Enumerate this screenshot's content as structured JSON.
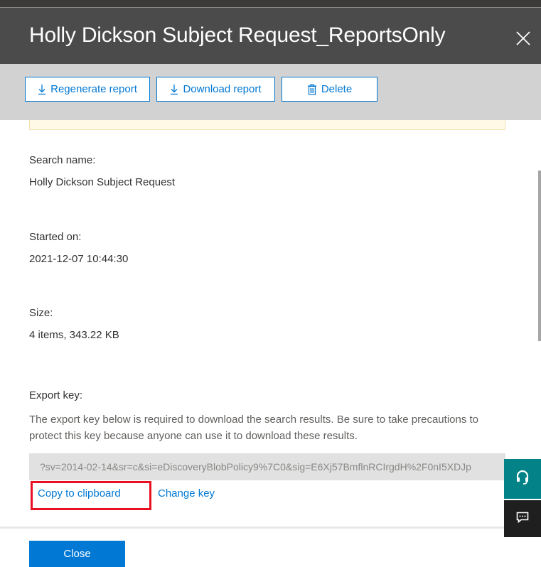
{
  "panel": {
    "title": "Holly Dickson Subject Request_ReportsOnly"
  },
  "toolbar": {
    "regenerate_label": "Regenerate report",
    "download_label": "Download report",
    "delete_label": "Delete"
  },
  "details": {
    "search_name_label": "Search name:",
    "search_name_value": "Holly Dickson Subject Request",
    "started_on_label": "Started on:",
    "started_on_value": "2021-12-07 10:44:30",
    "size_label": "Size:",
    "size_value": "4 items, 343.22 KB"
  },
  "export_key": {
    "label": "Export key:",
    "description": "The export key below is required to download the search results. Be sure to take precautions to protect this key because anyone can use it to download these results.",
    "value": "?sv=2014-02-14&sr=c&si=eDiscoveryBlobPolicy9%7C0&sig=E6Xj57BmflnRCIrgdH%2F0nI5XDJp",
    "copy_label": "Copy to clipboard",
    "change_label": "Change key"
  },
  "footer": {
    "close_label": "Close"
  },
  "colors": {
    "accent": "#0078d4",
    "header_bg": "#4b4b4b",
    "toolbar_bg": "#d2d2d2",
    "highlight": "#e81123",
    "help_bg": "#038387"
  },
  "icons": {
    "close": "close-icon",
    "regenerate": "download-arrow-icon",
    "download": "download-arrow-icon",
    "delete": "trash-icon",
    "help": "help-headset-icon",
    "feedback": "feedback-icon"
  }
}
